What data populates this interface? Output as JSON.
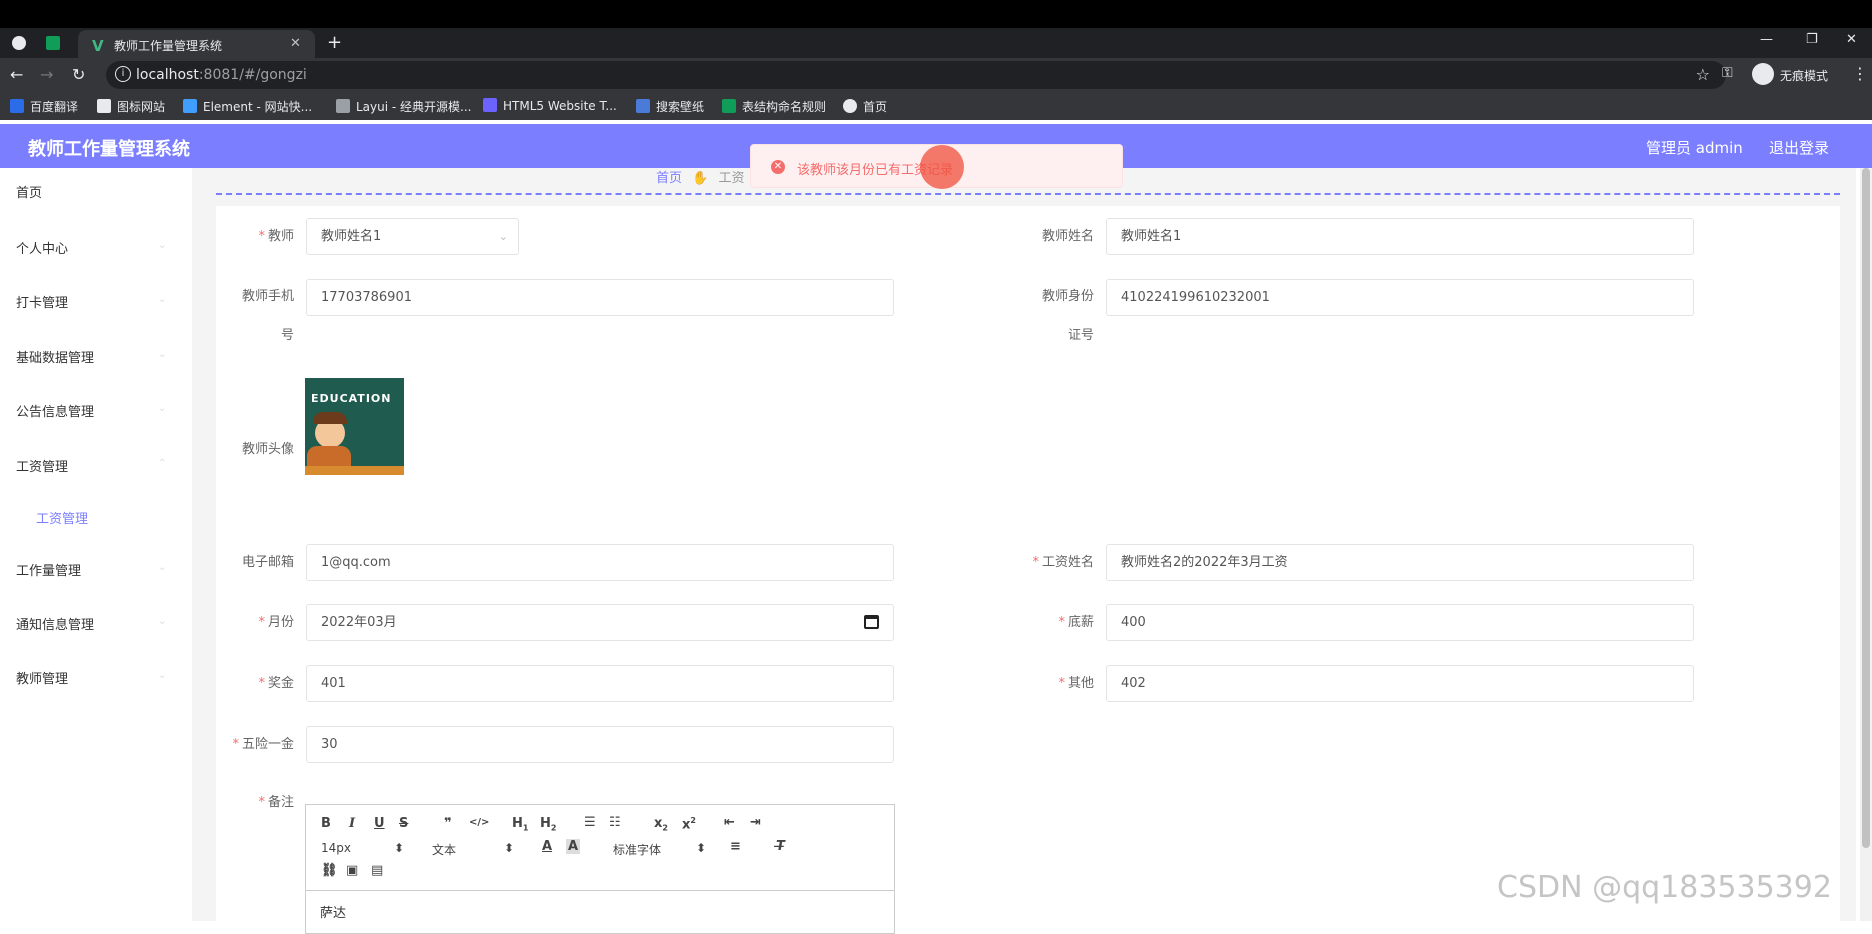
{
  "browser": {
    "tab_title": "教师工作量管理系统",
    "url_host": "localhost",
    "url_rest": ":8081/#/gongzi",
    "incognito_label": "无痕模式",
    "bookmarks": [
      "百度翻译",
      "图标网站",
      "Element - 网站快...",
      "Layui - 经典开源模...",
      "HTML5 Website T...",
      "搜索壁纸",
      "表结构命名规则",
      "首页"
    ]
  },
  "header": {
    "title": "教师工作量管理系统",
    "admin": "管理员 admin",
    "logout": "退出登录"
  },
  "sidebar": {
    "items": [
      "首页",
      "个人中心",
      "打卡管理",
      "基础数据管理",
      "公告信息管理",
      "工资管理",
      "工作量管理",
      "通知信息管理",
      "教师管理"
    ],
    "sub_item": "工资管理"
  },
  "breadcrumb": {
    "home": "首页",
    "current": "工资"
  },
  "toast": {
    "message": "该教师该月份已有工资记录"
  },
  "form": {
    "teacher_label": "教师",
    "teacher_value": "教师姓名1",
    "teacher_name_label": "教师姓名",
    "teacher_name_value": "教师姓名1",
    "phone_label_1": "教师手机",
    "phone_label_2": "号",
    "phone_value": "17703786901",
    "idcard_label_1": "教师身份",
    "idcard_label_2": "证号",
    "idcard_value": "410224199610232001",
    "avatar_label": "教师头像",
    "avatar_text": "EDUCATION",
    "email_label": "电子邮箱",
    "email_value": "1@qq.com",
    "salary_name_label": "工资姓名",
    "salary_name_value": "教师姓名2的2022年3月工资",
    "month_label": "月份",
    "month_value": "2022年03月",
    "base_label": "底薪",
    "base_value": "400",
    "bonus_label": "奖金",
    "bonus_value": "401",
    "other_label": "其他",
    "other_value": "402",
    "insurance_label": "五险一金",
    "insurance_value": "30",
    "remark_label": "备注",
    "remark_value": "萨达",
    "editor": {
      "font_size": "14px",
      "text_style": "文本",
      "font_family": "标准字体"
    }
  },
  "watermark": "CSDN @qq183535392"
}
